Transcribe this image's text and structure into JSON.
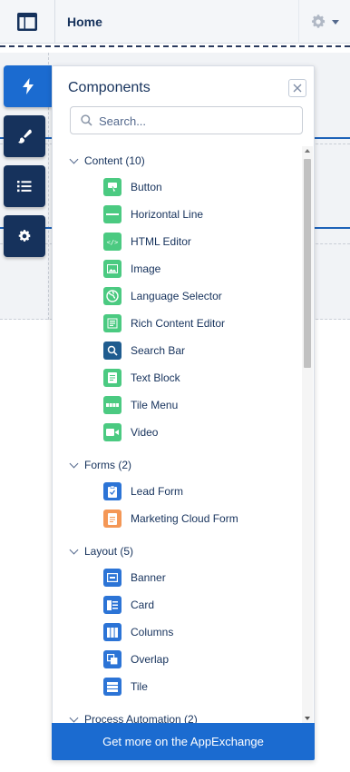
{
  "header": {
    "title": "Home"
  },
  "panel": {
    "title": "Components",
    "search_placeholder": "Search...",
    "footer_label": "Get more on the AppExchange"
  },
  "sections": [
    {
      "label": "Content (10)",
      "items": [
        {
          "label": "Button",
          "icon": "button-icon",
          "color": "#4bca81"
        },
        {
          "label": "Horizontal Line",
          "icon": "horizontal-line-icon",
          "color": "#4bca81"
        },
        {
          "label": "HTML Editor",
          "icon": "html-editor-icon",
          "color": "#4bca81"
        },
        {
          "label": "Image",
          "icon": "image-icon",
          "color": "#4bca81"
        },
        {
          "label": "Language Selector",
          "icon": "globe-icon",
          "color": "#4bca81"
        },
        {
          "label": "Rich Content Editor",
          "icon": "rich-content-icon",
          "color": "#4bca81"
        },
        {
          "label": "Search Bar",
          "icon": "search-bar-icon",
          "color": "#1f5c8f"
        },
        {
          "label": "Text Block",
          "icon": "text-block-icon",
          "color": "#4bca81"
        },
        {
          "label": "Tile Menu",
          "icon": "tile-menu-icon",
          "color": "#4bca81"
        },
        {
          "label": "Video",
          "icon": "video-icon",
          "color": "#4bca81"
        }
      ]
    },
    {
      "label": "Forms (2)",
      "items": [
        {
          "label": "Lead Form",
          "icon": "lead-form-icon",
          "color": "#2c74d6"
        },
        {
          "label": "Marketing Cloud Form",
          "icon": "marketing-form-icon",
          "color": "#f49756"
        }
      ]
    },
    {
      "label": "Layout (5)",
      "items": [
        {
          "label": "Banner",
          "icon": "banner-icon",
          "color": "#2c74d6"
        },
        {
          "label": "Card",
          "icon": "card-icon",
          "color": "#2c74d6"
        },
        {
          "label": "Columns",
          "icon": "columns-icon",
          "color": "#2c74d6"
        },
        {
          "label": "Overlap",
          "icon": "overlap-icon",
          "color": "#2c74d6"
        },
        {
          "label": "Tile",
          "icon": "tile-icon",
          "color": "#2c74d6"
        }
      ]
    },
    {
      "label": "Process Automation (2)",
      "items": []
    }
  ],
  "colors": {
    "accent": "#1b6bd0",
    "dock": "#16325c",
    "green": "#4bca81",
    "orange": "#f49756"
  }
}
